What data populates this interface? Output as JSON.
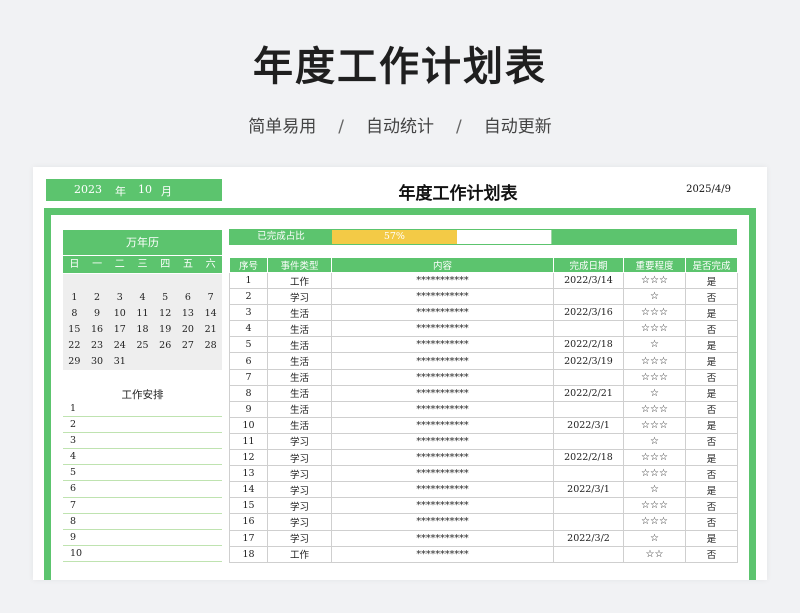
{
  "hero": {
    "title": "年度工作计划表",
    "features": [
      "简单易用",
      "自动统计",
      "自动更新"
    ],
    "separator": "/"
  },
  "sheet": {
    "year": "2023",
    "year_unit": "年",
    "month": "10",
    "month_unit": "月",
    "title": "年度工作计划表",
    "date": "2025/4/9"
  },
  "calendar": {
    "title": "万年历",
    "weekdays": [
      "日",
      "一",
      "二",
      "三",
      "四",
      "五",
      "六"
    ],
    "days": [
      "",
      "",
      "",
      "",
      "",
      "",
      "",
      "1",
      "2",
      "3",
      "4",
      "5",
      "6",
      "7",
      "8",
      "9",
      "10",
      "11",
      "12",
      "13",
      "14",
      "15",
      "16",
      "17",
      "18",
      "19",
      "20",
      "21",
      "22",
      "23",
      "24",
      "25",
      "26",
      "27",
      "28",
      "29",
      "30",
      "31",
      "",
      "",
      "",
      ""
    ]
  },
  "tasks": {
    "title": "工作安排",
    "items": [
      "1",
      "2",
      "3",
      "4",
      "5",
      "6",
      "7",
      "8",
      "9",
      "10"
    ]
  },
  "progress": {
    "label": "已完成占比",
    "value_text": "57%",
    "value": 0.57,
    "bar_color": "#f3ca46"
  },
  "table": {
    "headers": [
      "序号",
      "事件类型",
      "内容",
      "完成日期",
      "重要程度",
      "是否完成"
    ],
    "rows": [
      [
        "1",
        "工作",
        "***********",
        "2022/3/14",
        "☆☆☆",
        "是"
      ],
      [
        "2",
        "学习",
        "***********",
        "",
        "☆",
        "否"
      ],
      [
        "3",
        "生活",
        "***********",
        "2022/3/16",
        "☆☆☆",
        "是"
      ],
      [
        "4",
        "生活",
        "***********",
        "",
        "☆☆☆",
        "否"
      ],
      [
        "5",
        "生活",
        "***********",
        "2022/2/18",
        "☆",
        "是"
      ],
      [
        "6",
        "生活",
        "***********",
        "2022/3/19",
        "☆☆☆",
        "是"
      ],
      [
        "7",
        "生活",
        "***********",
        "",
        "☆☆☆",
        "否"
      ],
      [
        "8",
        "生活",
        "***********",
        "2022/2/21",
        "☆",
        "是"
      ],
      [
        "9",
        "生活",
        "***********",
        "",
        "☆☆☆",
        "否"
      ],
      [
        "10",
        "生活",
        "***********",
        "2022/3/1",
        "☆☆☆",
        "是"
      ],
      [
        "11",
        "学习",
        "***********",
        "",
        "☆",
        "否"
      ],
      [
        "12",
        "学习",
        "***********",
        "2022/2/18",
        "☆☆☆",
        "是"
      ],
      [
        "13",
        "学习",
        "***********",
        "",
        "☆☆☆",
        "否"
      ],
      [
        "14",
        "学习",
        "***********",
        "2022/3/1",
        "☆",
        "是"
      ],
      [
        "15",
        "学习",
        "***********",
        "",
        "☆☆☆",
        "否"
      ],
      [
        "16",
        "学习",
        "***********",
        "",
        "☆☆☆",
        "否"
      ],
      [
        "17",
        "学习",
        "***********",
        "2022/3/2",
        "☆",
        "是"
      ],
      [
        "18",
        "工作",
        "***********",
        "",
        "☆☆",
        "否"
      ]
    ]
  },
  "colors": {
    "accent": "#5cc46e"
  }
}
